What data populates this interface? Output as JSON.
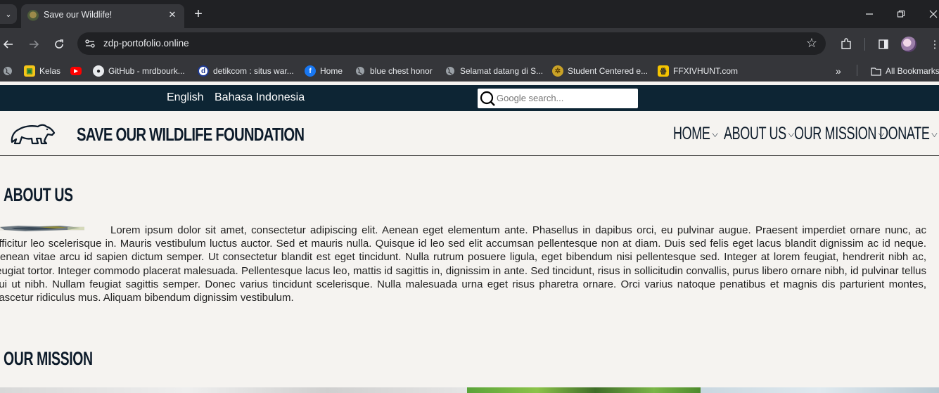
{
  "browser": {
    "tab_title": "Save our Wildlife!",
    "url": "zdp-portofolio.online",
    "bookmarks": [
      {
        "label": "",
        "icon": "globe-icon"
      },
      {
        "label": "Kelas",
        "icon": "classroom-icon"
      },
      {
        "label": "",
        "icon": "youtube-icon"
      },
      {
        "label": "GitHub - mrdbourk...",
        "icon": "github-icon"
      },
      {
        "label": "detikcom : situs war...",
        "icon": "detik-icon"
      },
      {
        "label": "Home",
        "icon": "facebook-icon"
      },
      {
        "label": "blue chest honor",
        "icon": "globe-icon"
      },
      {
        "label": "Selamat datang di S...",
        "icon": "globe-icon"
      },
      {
        "label": "Student Centered e...",
        "icon": "university-icon"
      },
      {
        "label": "FFXIVHUNT.com",
        "icon": "ffxivhunt-icon"
      }
    ],
    "all_bookmarks": "All Bookmarks"
  },
  "page": {
    "languages": [
      "English",
      "Bahasa Indonesia"
    ],
    "search_placeholder": "Google search...",
    "brand": "SAVE OUR WILDLIFE FOUNDATION",
    "menu": [
      "HOME",
      "ABOUT US",
      "OUR MISSION",
      "DONATE"
    ],
    "about": {
      "title": "ABOUT US",
      "text": "Lorem ipsum dolor sit amet, consectetur adipiscing elit. Aenean eget elementum ante. Phasellus in dapibus orci, eu pulvinar augue. Praesent imperdiet ornare nunc, ac efficitur leo scelerisque in. Mauris vestibulum luctus auctor. Sed et mauris nulla. Quisque id leo sed elit accumsan pellentesque non at diam. Duis sed felis eget lacus blandit dignissim ac id neque. Aenean vitae arcu id sapien dictum semper. Ut consectetur blandit est eget tincidunt. Nulla rutrum posuere ligula, eget bibendum nisi pellentesque sed. Integer at lorem feugiat, hendrerit nibh ac, feugiat tortor. Integer commodo placerat malesuada. Pellentesque lacus leo, mattis id sagittis in, dignissim in ante. Sed tincidunt, risus in sollicitudin convallis, purus libero ornare nibh, id pulvinar tellus dui ut nibh. Nullam feugiat sagittis semper. Donec varius tincidunt scelerisque. Nulla malesuada urna eget risus pharetra ornare. Orci varius natoque penatibus et magnis dis parturient montes, nascetur ridiculus mus. Aliquam bibendum dignissim vestibulum."
    },
    "mission": {
      "title": "OUR MISSION"
    }
  },
  "colors": {
    "langbar": "#0d2534",
    "page_bg": "#f5f3f0",
    "heading": "#0d1b2a"
  }
}
